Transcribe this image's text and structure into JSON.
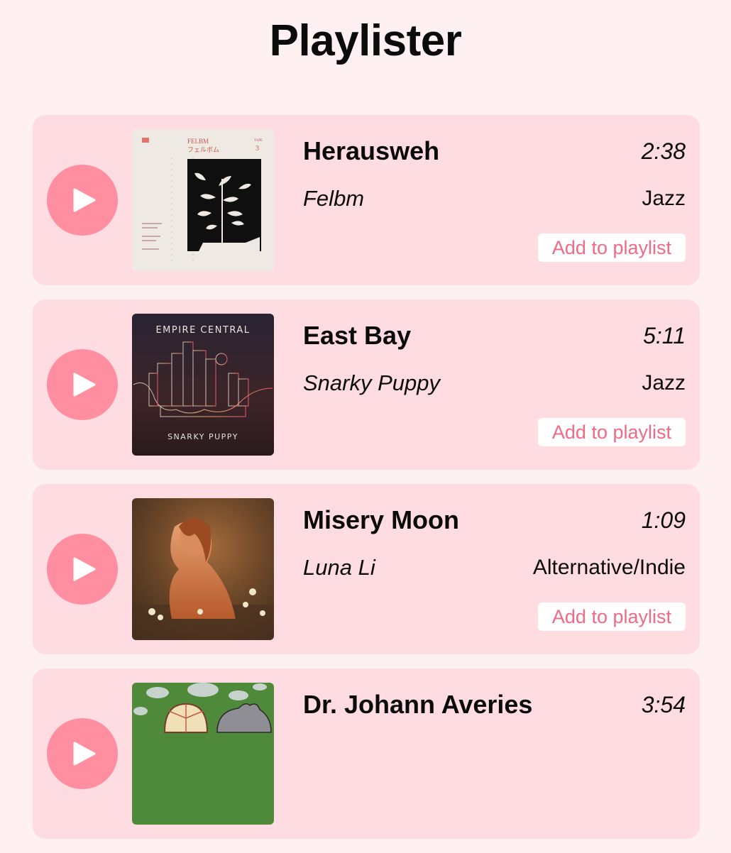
{
  "app": {
    "title": "Playlister"
  },
  "colors": {
    "background": "#fff1f2",
    "card": "#ffdce1",
    "play_button": "#ff8ea0",
    "accent": "#f06a86"
  },
  "tracks": [
    {
      "title": "Herausweh",
      "duration": "2:38",
      "artist": "Felbm",
      "genre": "Jazz",
      "add_label": "Add to playlist",
      "play_icon": "play-icon",
      "cover": {
        "header": "FELBM",
        "subheader": "フェルボム",
        "tape": "TAPE",
        "number": "3"
      }
    },
    {
      "title": "East Bay",
      "duration": "5:11",
      "artist": "Snarky Puppy",
      "genre": "Jazz",
      "add_label": "Add to playlist",
      "play_icon": "play-icon",
      "cover": {
        "header": "EMPIRE CENTRAL",
        "footer": "SNARKY PUPPY"
      }
    },
    {
      "title": "Misery Moon",
      "duration": "1:09",
      "artist": "Luna Li",
      "genre": "Alternative/Indie",
      "add_label": "Add to playlist",
      "play_icon": "play-icon"
    },
    {
      "title": "Dr. Johann Averies",
      "duration": "3:54",
      "play_icon": "play-icon"
    }
  ]
}
